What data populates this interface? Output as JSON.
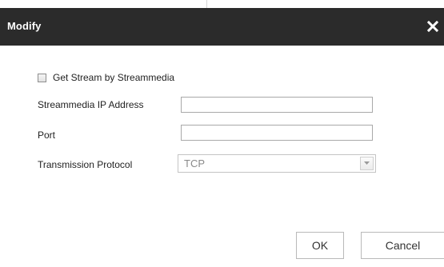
{
  "dialog": {
    "title": "Modify",
    "close_icon": "close-icon"
  },
  "form": {
    "get_stream_checkbox": {
      "label": "Get Stream by Streammedia",
      "checked": false
    },
    "streammedia_ip": {
      "label": "Streammedia IP Address",
      "value": ""
    },
    "port": {
      "label": "Port",
      "value": ""
    },
    "transmission_protocol": {
      "label": "Transmission Protocol",
      "selected": "TCP",
      "arrow_icon": "chevron-down-icon"
    }
  },
  "buttons": {
    "ok_label": "OK",
    "cancel_label": "Cancel"
  },
  "colors": {
    "titlebar": "#2b2b2b",
    "title_text": "#ffffff",
    "disabled_text": "#8a8a8a"
  }
}
